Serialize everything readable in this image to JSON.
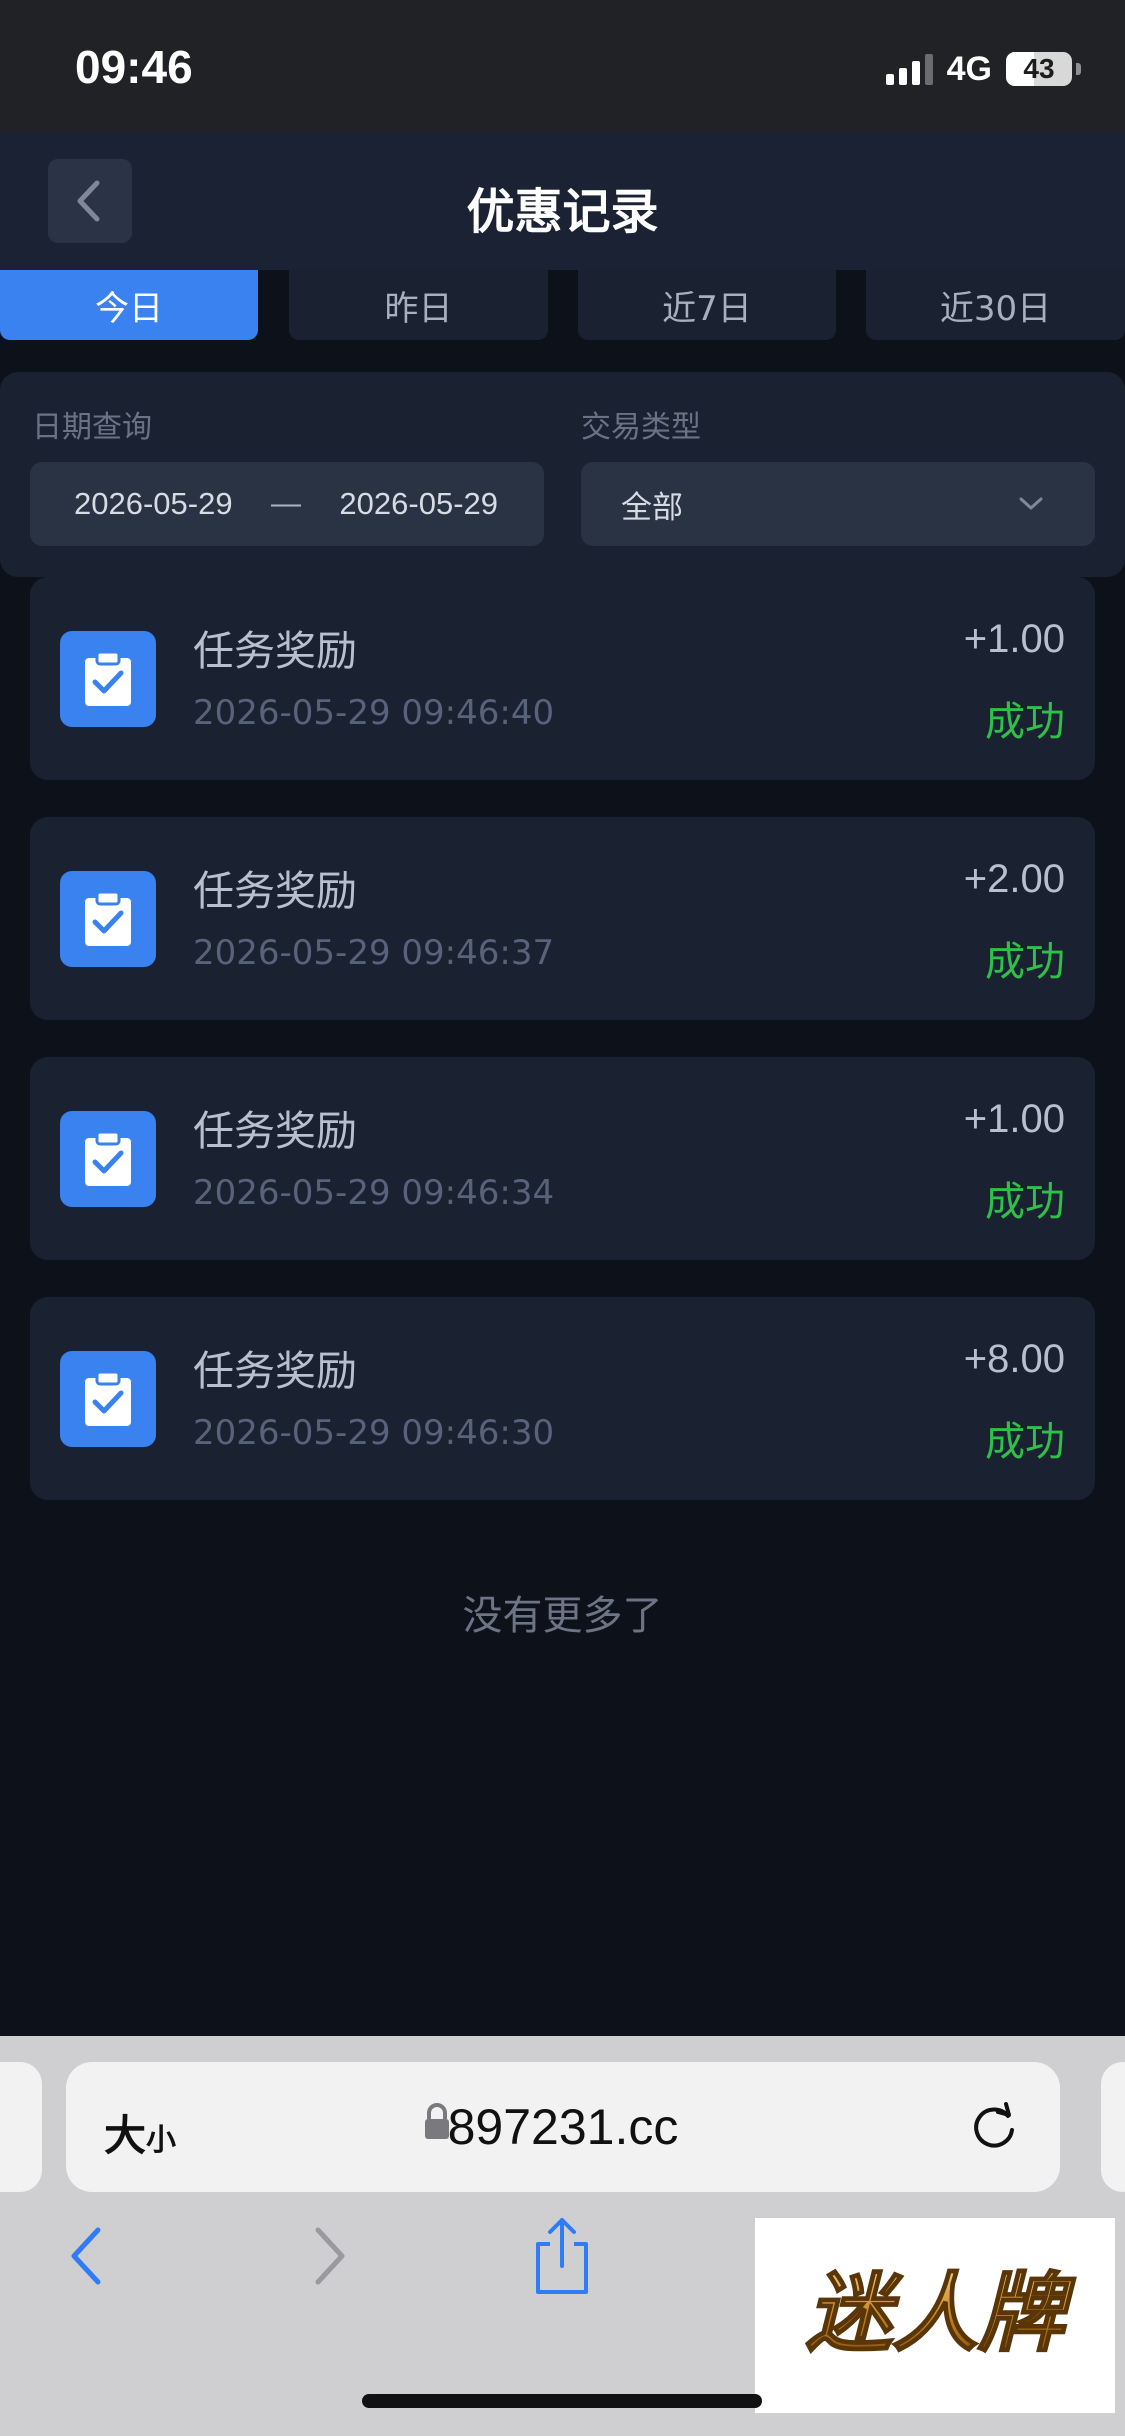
{
  "status_bar": {
    "time": "09:46",
    "network": "4G",
    "battery_level": "43",
    "battery_fraction": 0.43
  },
  "header": {
    "title": "优惠记录",
    "back_icon": "chevron-left-icon"
  },
  "tabs": [
    {
      "label": "今日",
      "active": true
    },
    {
      "label": "昨日",
      "active": false
    },
    {
      "label": "近7日",
      "active": false
    },
    {
      "label": "近30日",
      "active": false
    }
  ],
  "filter": {
    "date_label": "日期查询",
    "date_start": "2026-05-29",
    "date_separator": "—",
    "date_end": "2026-05-29",
    "type_label": "交易类型",
    "type_value": "全部"
  },
  "records": [
    {
      "title": "任务奖励",
      "time": "2026-05-29 09:46:40",
      "amount": "+1.00",
      "status": "成功"
    },
    {
      "title": "任务奖励",
      "time": "2026-05-29 09:46:37",
      "amount": "+2.00",
      "status": "成功"
    },
    {
      "title": "任务奖励",
      "time": "2026-05-29 09:46:34",
      "amount": "+1.00",
      "status": "成功"
    },
    {
      "title": "任务奖励",
      "time": "2026-05-29 09:46:30",
      "amount": "+8.00",
      "status": "成功"
    }
  ],
  "list_end_text": "没有更多了",
  "browser": {
    "text_size_big": "大",
    "text_size_small": "小",
    "url": "897231.cc"
  },
  "watermark": {
    "text": "迷人牌"
  },
  "colors": {
    "accent": "#3a82f0",
    "success": "#2ec04a",
    "background": "#0d111a",
    "card": "#1a2231"
  }
}
